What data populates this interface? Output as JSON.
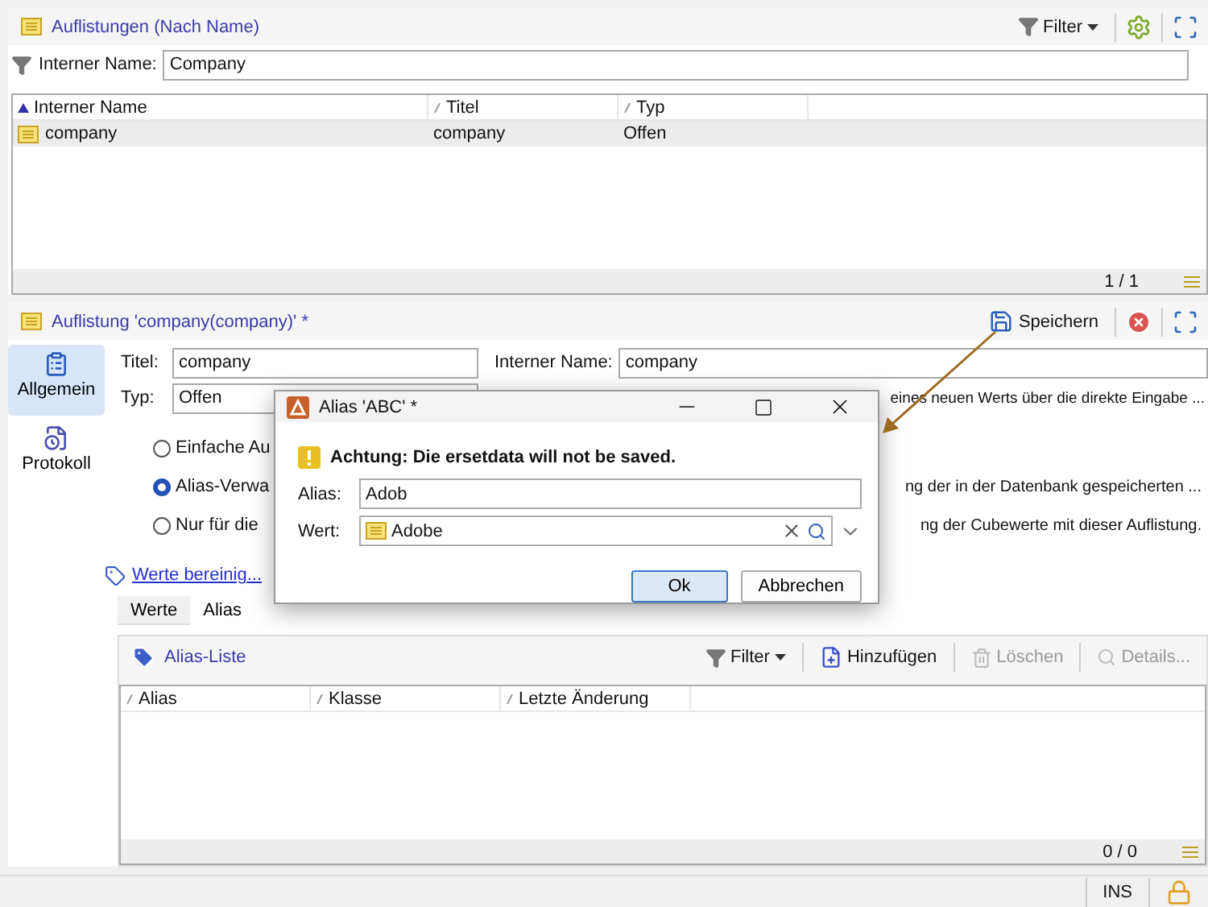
{
  "list_panel": {
    "title": "Auflistungen (Nach Name)",
    "filter_button": "Filter",
    "filter": {
      "label": "Interner Name:",
      "value": "Company"
    },
    "table": {
      "columns": [
        {
          "label": "Interner Name",
          "sorted": true
        },
        {
          "label": "Titel",
          "sorted": false
        },
        {
          "label": "Typ",
          "sorted": false
        }
      ],
      "rows": [
        {
          "cells": [
            "company",
            "company",
            "Offen"
          ],
          "selected": true
        }
      ]
    },
    "pager": "1 / 1"
  },
  "detail_panel": {
    "title": "Auflistung 'company(company)' *",
    "save_button": "Speichern",
    "sidebar": [
      {
        "label": "Allgemein",
        "selected": true
      },
      {
        "label": "Protokoll",
        "selected": false
      }
    ],
    "titel": {
      "label": "Titel:",
      "value": "company"
    },
    "typ": {
      "label": "Typ:",
      "value": "Offen"
    },
    "internal_name": {
      "label": "Interner Name:",
      "value": "company"
    },
    "description_tail": "eines neuen Werts über die direkte Eingabe ...",
    "radios": [
      {
        "label": "Einfache Au",
        "selected": false
      },
      {
        "label": "Alias-Verwa",
        "tail": "ng der in der Datenbank gespeicherten ...",
        "selected": true
      },
      {
        "label": "Nur für die",
        "tail": "ng der Cubewerte mit dieser Auflistung.",
        "selected": false
      }
    ],
    "clean_link": "Werte bereinig...",
    "tabs": [
      {
        "label": "Werte",
        "selected": false
      },
      {
        "label": "Alias",
        "selected": true
      }
    ],
    "alias_list": {
      "title": "Alias-Liste",
      "toolbar": [
        {
          "kind": "filter",
          "label": "Filter",
          "disabled": false
        },
        {
          "kind": "add",
          "label": "Hinzufügen",
          "disabled": false
        },
        {
          "kind": "delete",
          "label": "Löschen",
          "disabled": true
        },
        {
          "kind": "details",
          "label": "Details...",
          "disabled": true
        }
      ],
      "columns": [
        "Alias",
        "Klasse",
        "Letzte Änderung"
      ],
      "pager": "0 / 0"
    }
  },
  "status_bar": {
    "mode": "INS"
  },
  "dialog": {
    "title": "Alias 'ABC' *",
    "warning": "Achtung: Die ersetdata will not be saved.",
    "alias": {
      "label": "Alias:",
      "value": "Adob"
    },
    "wert": {
      "label": "Wert:",
      "value": "Adobe"
    },
    "buttons": [
      {
        "label": "Ok",
        "default": true
      },
      {
        "label": "Abbrechen",
        "default": false
      }
    ]
  }
}
